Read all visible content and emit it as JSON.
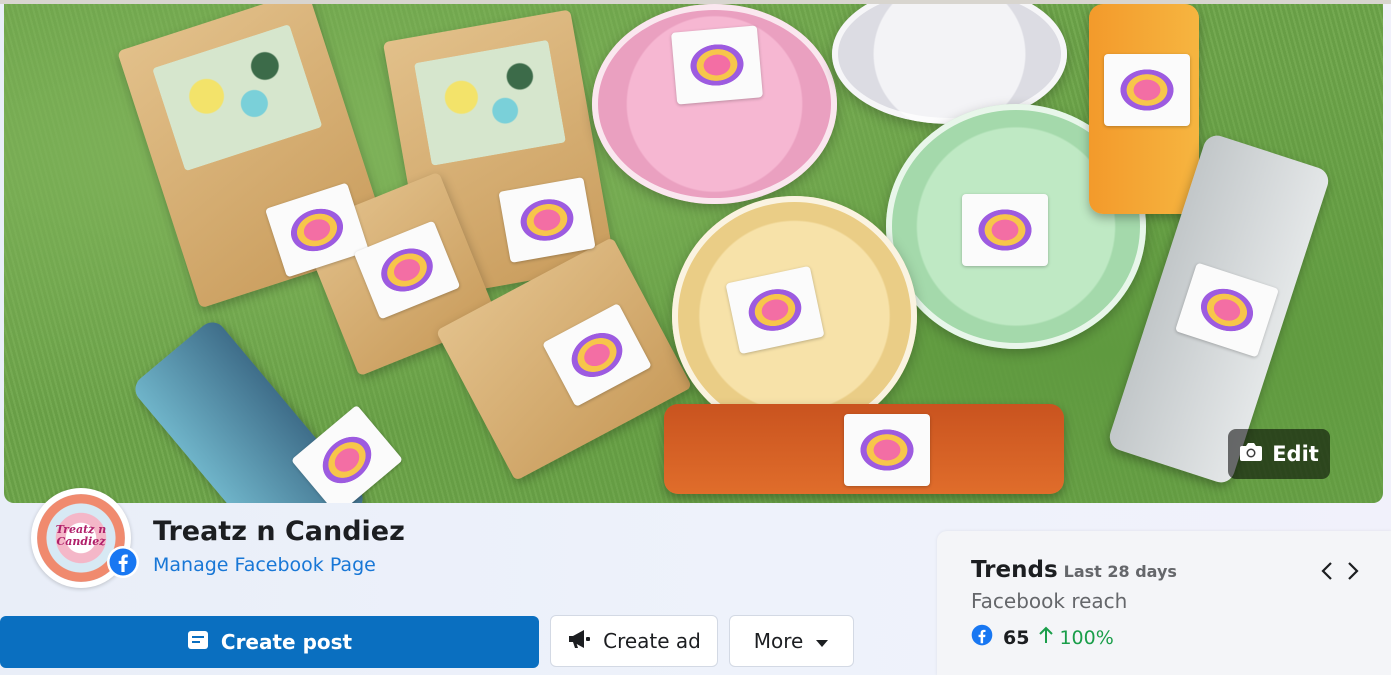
{
  "cover": {
    "edit_label": "Edit"
  },
  "profile": {
    "avatar_text": "Treatz n Candiez",
    "page_name": "Treatz n Candiez",
    "manage_link": "Manage Facebook Page"
  },
  "actions": {
    "create_post": "Create post",
    "create_ad": "Create ad",
    "more": "More"
  },
  "trends": {
    "title": "Trends",
    "period": "Last 28 days",
    "metric": "Facebook reach",
    "value": "65",
    "change": "100%"
  },
  "colors": {
    "primary": "#0a6fc0",
    "link": "#1877d6",
    "positive": "#1a9e4a",
    "facebook": "#1877f2"
  }
}
